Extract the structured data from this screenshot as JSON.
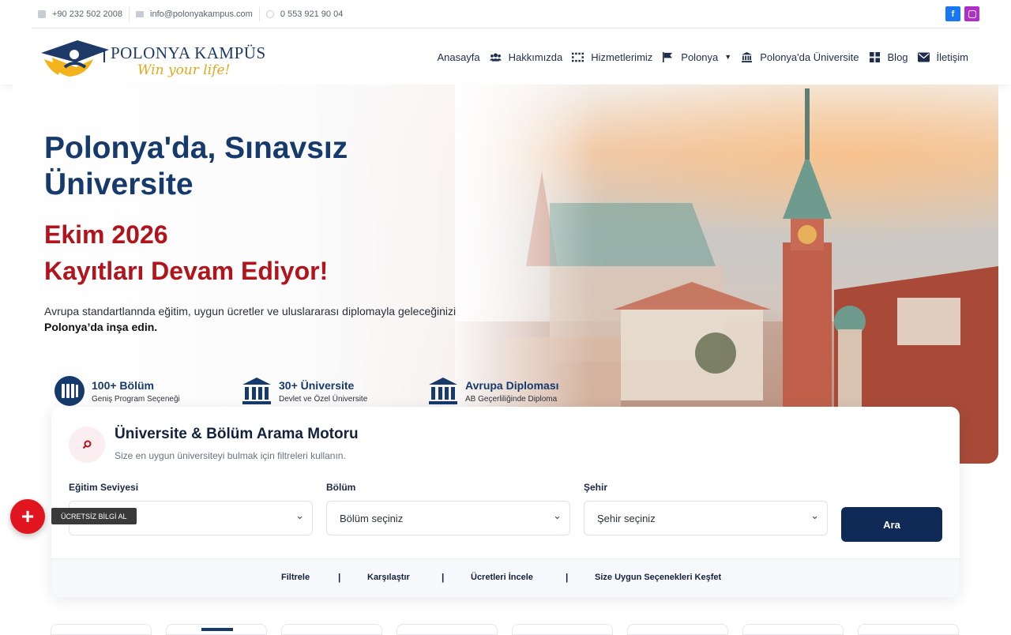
{
  "topbar": {
    "phone": "+90 232 502 2008",
    "email": "info@polonyakampus.com",
    "whatsapp": "0 553 921 90 04",
    "socials": [
      {
        "name": "facebook-icon",
        "label": "f"
      },
      {
        "name": "instagram-icon",
        "label": ""
      }
    ]
  },
  "logo": {
    "name": "POLONYA KAMPÜS",
    "slogan": "Win your life!"
  },
  "nav": {
    "items": [
      {
        "label": "Anasayfa",
        "icon": ""
      },
      {
        "label": "Hakkımızda",
        "icon": "users-icon"
      },
      {
        "label": "Hizmetlerimiz",
        "icon": "grid-dots-icon"
      },
      {
        "label": "Polonya",
        "icon": "flag-icon"
      },
      {
        "label": "Polonya'da Üniversite",
        "icon": "university-icon"
      },
      {
        "label": "Blog",
        "icon": "blog-grid-icon"
      },
      {
        "label": "İletişim",
        "icon": "envelope-icon"
      }
    ]
  },
  "hero": {
    "title_line1": "Polonya'da, Sınavsız",
    "title_line2": "Üniversite",
    "sub_line1": "Ekim 2026",
    "sub_line2": "Kayıtları Devam Ediyor!",
    "desc": "Avrupa standartlannda eğitim, uygun ücretler ve uluslararası diplomayla geleceğinizi",
    "desc_bold": "Polonya’da inşa edin.",
    "features": [
      {
        "title": "100+ Bölüm",
        "sub": "Geniş Program Seçeneği"
      },
      {
        "title": "30+ Üniversite",
        "sub": "Devlet ve Özel Üniversite"
      },
      {
        "title": "Avrupa Diploması",
        "sub": "AB Geçerliliğinde Diploma"
      }
    ]
  },
  "search": {
    "title": "Üniversite & Bölüm Arama Motoru",
    "subtitle": "Size en uygun üniversiteyi bulmak için filtreleri kullanın.",
    "fields": [
      {
        "label": "Eğitim Seviyesi",
        "value": ""
      },
      {
        "label": "Bölüm",
        "value": "Bölüm seçiniz"
      },
      {
        "label": "Şehir",
        "value": "Şehir seçiniz"
      }
    ],
    "button": "Ara",
    "links": [
      "Filtrele",
      "Karşılaştır",
      "Ücretleri İncele",
      "Size Uygun Seçenekleri Keşfet"
    ],
    "separator": "|"
  },
  "fab": {
    "icon": "+",
    "label": "ÜCRETSİZ BİLGİ AL"
  },
  "colors": {
    "primary": "#153a6b",
    "accent_red": "#b1141b",
    "logo_gold": "#e2a81b",
    "button": "#0f2a57",
    "fab": "#e0151f"
  }
}
